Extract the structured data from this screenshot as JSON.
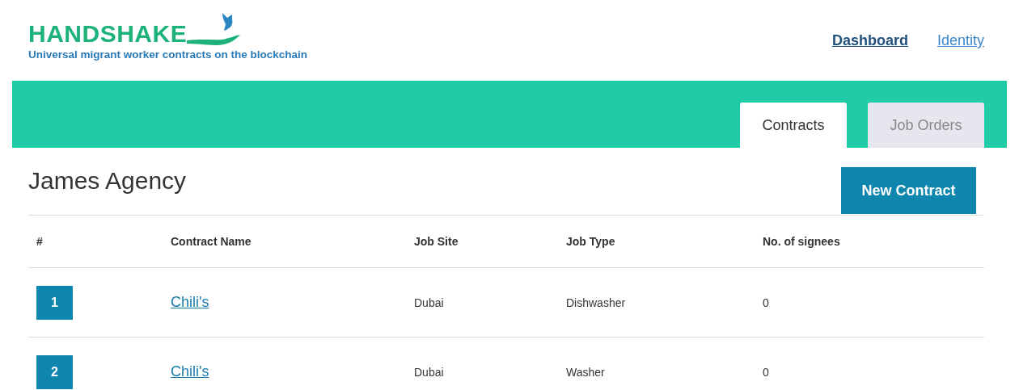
{
  "brand": {
    "name": "HANDSHAKE",
    "tagline": "Universal migrant worker contracts on the blockchain"
  },
  "nav": [
    {
      "label": "Dashboard",
      "selected": true
    },
    {
      "label": "Identity",
      "selected": false
    }
  ],
  "tabs": [
    {
      "label": "Contracts",
      "selected": true
    },
    {
      "label": "Job Orders",
      "selected": false
    }
  ],
  "page_title": "James Agency",
  "new_button": "New Contract",
  "table": {
    "columns": [
      "#",
      "Contract Name",
      "Job Site",
      "Job Type",
      "No. of signees"
    ],
    "rows": [
      {
        "number": "1",
        "name": "Chili's",
        "site": "Dubai",
        "type": "Dishwasher",
        "signees": "0"
      },
      {
        "number": "2",
        "name": "Chili's",
        "site": "Dubai",
        "type": "Washer",
        "signees": "0"
      }
    ]
  }
}
